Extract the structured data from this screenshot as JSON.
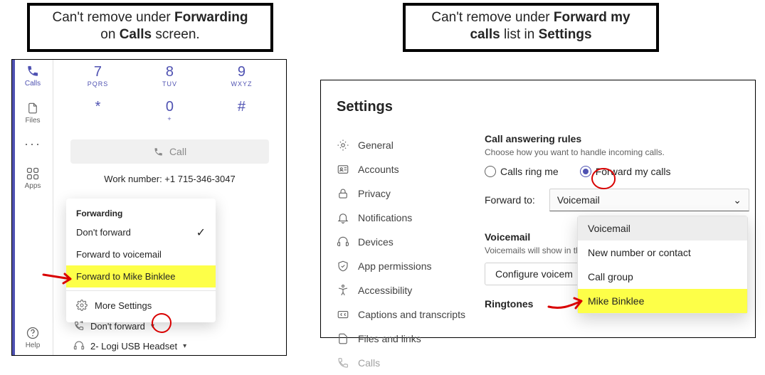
{
  "captions": {
    "left_line1_pre": "Can't remove under ",
    "left_line1_b": "Forwarding",
    "left_line2_pre": "on ",
    "left_line2_b": "Calls",
    "left_line2_post": " screen.",
    "right_line1_pre": "Can't remove under ",
    "right_line1_b": "Forward my",
    "right_line2_b": "calls",
    "right_line2_mid": " list in ",
    "right_line2_b2": "Settings"
  },
  "rail": {
    "calls": "Calls",
    "files": "Files",
    "apps": "Apps",
    "help": "Help"
  },
  "dial": {
    "k7": {
      "n": "7",
      "l": "PQRS"
    },
    "k8": {
      "n": "8",
      "l": "TUV"
    },
    "k9": {
      "n": "9",
      "l": "WXYZ"
    },
    "star": {
      "n": "*",
      "l": ""
    },
    "k0": {
      "n": "0",
      "l": "+"
    },
    "hash": {
      "n": "#",
      "l": ""
    }
  },
  "call_btn": "Call",
  "work_number_label": "Work number: ",
  "work_number": "+1 715-346-3047",
  "forward_popup": {
    "header": "Forwarding",
    "opt_dont": "Don't forward",
    "opt_vm": "Forward to voicemail",
    "opt_person": "Forward to Mike Binklee",
    "more": "More Settings"
  },
  "below": {
    "dont_forward": "Don't forward",
    "device": "2- Logi USB Headset"
  },
  "settings": {
    "title": "Settings",
    "nav": {
      "general": "General",
      "accounts": "Accounts",
      "privacy": "Privacy",
      "notifications": "Notifications",
      "devices": "Devices",
      "app_perm": "App permissions",
      "accessibility": "Accessibility",
      "captions": "Captions and transcripts",
      "files": "Files and links",
      "calls": "Calls"
    },
    "rules_h": "Call answering rules",
    "rules_sub": "Choose how you want to handle incoming calls.",
    "radio_ring": "Calls ring me",
    "radio_fwd": "Forward my calls",
    "fwd_to": "Forward to:",
    "select_value": "Voicemail",
    "dropdown": {
      "vm": "Voicemail",
      "new": "New number or contact",
      "group": "Call group",
      "person": "Mike Binklee"
    },
    "vm_h": "Voicemail",
    "vm_sub_visible": "Voicemails will show in th",
    "conf_btn_visible": "Configure voicem",
    "rt_h": "Ringtones"
  }
}
